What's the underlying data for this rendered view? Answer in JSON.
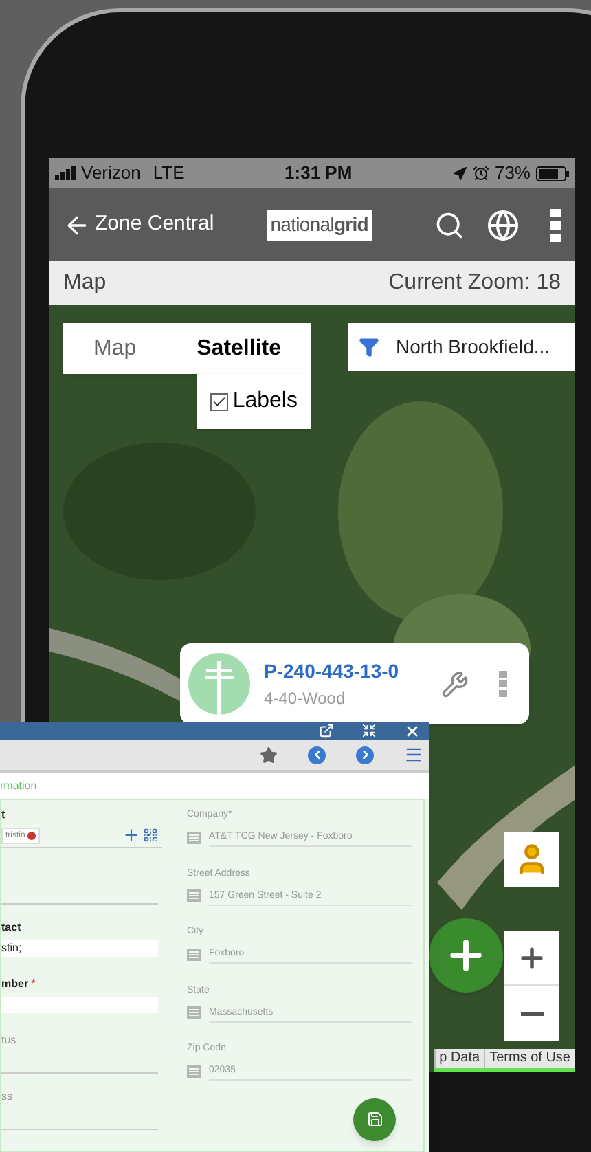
{
  "status_bar": {
    "carrier": "Verizon",
    "network": "LTE",
    "time": "1:31 PM",
    "battery": "73%"
  },
  "app_bar": {
    "back_label": "Zone Central",
    "logo_light": "national",
    "logo_bold": "grid"
  },
  "subheader": {
    "title": "Map",
    "zoom": "Current Zoom: 18"
  },
  "map_type_tabs": [
    {
      "label": "Map",
      "selected": false
    },
    {
      "label": "Satellite",
      "selected": true
    }
  ],
  "labels_checkbox": {
    "label": "Labels",
    "checked": true
  },
  "filter": {
    "value": "North Brookfield..."
  },
  "asset_card": {
    "id": "P-240-443-13-0",
    "subtitle": "4-40-Wood"
  },
  "attribution": [
    "p Data",
    "Terms of Use"
  ],
  "form_window": {
    "tab": "rmation",
    "left_fields": [
      {
        "kind": "chip",
        "label": "t",
        "chip": "tristin"
      },
      {
        "kind": "line"
      },
      {
        "kind": "input",
        "label": "tact",
        "value": "stin;"
      },
      {
        "kind": "input",
        "label": "mber",
        "required_mark": "*"
      },
      {
        "kind": "line",
        "label": "tus"
      },
      {
        "kind": "line",
        "label": "ss"
      }
    ],
    "right_fields": [
      {
        "label": "Company*",
        "value": "AT&T TCG New Jersey - Foxboro"
      },
      {
        "label": "Street Address",
        "value": "157 Green Street - Suite 2"
      },
      {
        "label": "City",
        "value": "Foxboro"
      },
      {
        "label": "State",
        "value": "Massachusetts"
      },
      {
        "label": "Zip Code",
        "value": "02035"
      }
    ]
  }
}
